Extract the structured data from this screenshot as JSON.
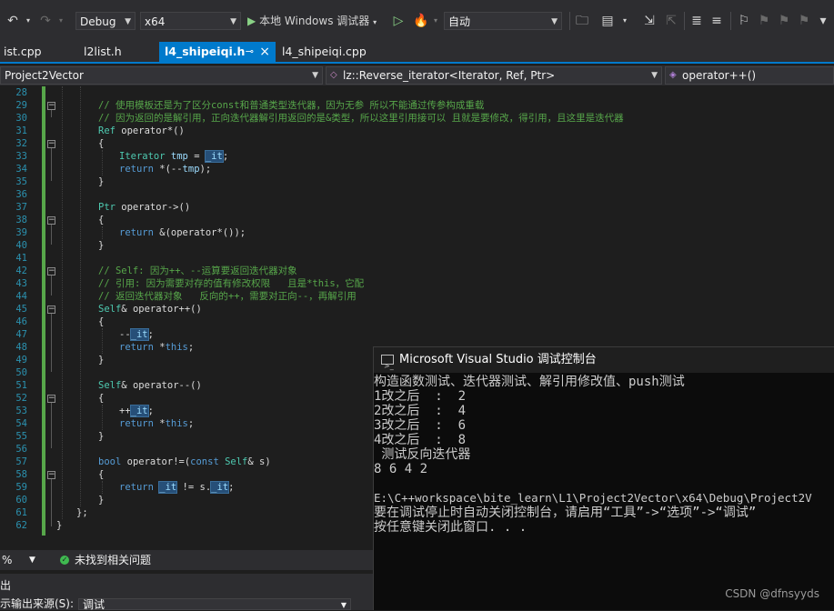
{
  "toolbar": {
    "config": "Debug",
    "platform": "x64",
    "debugger": "本地 Windows 调试器",
    "auto": "自动"
  },
  "tabs": [
    {
      "label": "ist.cpp"
    },
    {
      "label": "l2list.h"
    },
    {
      "label": "l4_shipeiqi.h",
      "pin": "⊸",
      "close": "×"
    },
    {
      "label": "l4_shipeiqi.cpp"
    }
  ],
  "navbar": {
    "project": "Project2Vector",
    "scope": "lz::Reverse_iterator<Iterator, Ref, Ptr>",
    "member": "operator++()"
  },
  "line_numbers": [
    "28",
    "29",
    "30",
    "31",
    "32",
    "33",
    "34",
    "35",
    "36",
    "37",
    "38",
    "39",
    "40",
    "41",
    "42",
    "43",
    "44",
    "45",
    "46",
    "47",
    "48",
    "49",
    "50",
    "51",
    "52",
    "53",
    "54",
    "55",
    "56",
    "57",
    "58",
    "59",
    "60",
    "61",
    "62"
  ],
  "code": {
    "l29": "// 使用模板还是为了区分const和普通类型迭代器，因为无参 所以不能通过传参构成重载",
    "l30": "// 因为返回的是解引用，正向迭代器解引用返回的是&类型，所以这里引用接可以 且就是要修改，得引用，且这里是迭代器",
    "l31a": "Ref",
    "l31b": " operator*()",
    "l32": "{",
    "l33a": "Iterator",
    "l33b": "tmp",
    "l33c": " = ",
    "l33d": "_it",
    "l33e": ";",
    "l34a": "return",
    "l34b": " *(--",
    "l34c": "tmp",
    "l34d": ");",
    "l35": "}",
    "l37a": "Ptr",
    "l37b": " operator->()",
    "l38": "{",
    "l39a": "return",
    "l39b": " &(operator*());",
    "l40": "}",
    "l42": "// Self: 因为++、--运算要返回迭代器对象",
    "l43": "// 引用: 因为需要对存的值有修改权限   且是*this，它配",
    "l44": "// 返回迭代器对象   反向的++，需要对正向--，再解引用",
    "l45a": "Self",
    "l45b": "& operator++()",
    "l46": "{",
    "l47a": "--",
    "l47b": "_it",
    "l47c": ";",
    "l48a": "return",
    "l48b": " *",
    "l48c": "this",
    "l48d": ";",
    "l49": "}",
    "l51a": "Self",
    "l51b": "& operator--()",
    "l52": "{",
    "l53a": "++",
    "l53b": "_it",
    "l53c": ";",
    "l54a": "return",
    "l54b": " *",
    "l54c": "this",
    "l54d": ";",
    "l55": "}",
    "l57a": "bool",
    "l57b": " operator!=(",
    "l57c": "const",
    "l57d": " ",
    "l57e": "Self",
    "l57f": "& s)",
    "l58": "{",
    "l59a": "return",
    "l59b": " ",
    "l59c": "_it",
    "l59d": " != s.",
    "l59e": "_it",
    "l59f": ";",
    "l60": "}",
    "l61": "};",
    "l62": "}"
  },
  "status": {
    "zoom": "%",
    "issues": "未找到相关问题"
  },
  "output": {
    "title": "出",
    "source_label": "示输出来源(S):",
    "source_value": "调试"
  },
  "console": {
    "title": "Microsoft Visual Studio 调试控制台",
    "lines": [
      "构造函数测试、迭代器测试、解引用修改值、push测试",
      "1改之后  :  2",
      "2改之后  :  4",
      "3改之后  :  6",
      "4改之后  :  8",
      " 测试反向迭代器",
      "8 6 4 2",
      "",
      "E:\\C++workspace\\bite_learn\\L1\\Project2Vector\\x64\\Debug\\Project2V",
      "要在调试停止时自动关闭控制台，请启用“工具”->“选项”->“调试”",
      "按任意键关闭此窗口. . ."
    ]
  },
  "watermark": "CSDN @dfnsyyds",
  "colors": {
    "accent": "#007acc",
    "comment": "#57a64a",
    "keyword": "#569cd6",
    "type": "#4ec9b0",
    "identifier": "#9cdcfe"
  }
}
